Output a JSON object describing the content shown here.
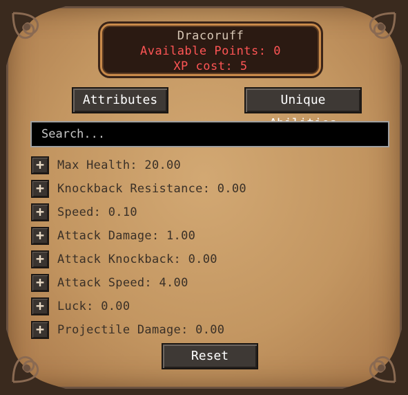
{
  "header": {
    "name": "Dracoruff",
    "available_points": "Available Points: 0",
    "xp_cost": "XP cost: 5"
  },
  "tabs": {
    "attributes_label": "Attributes",
    "unique_label": "Unique Abilities"
  },
  "search": {
    "placeholder": "Search..."
  },
  "attributes": [
    {
      "label": "Max Health: 20.00"
    },
    {
      "label": "Knockback Resistance: 0.00"
    },
    {
      "label": "Speed: 0.10"
    },
    {
      "label": "Attack Damage: 1.00"
    },
    {
      "label": "Attack Knockback: 0.00"
    },
    {
      "label": "Attack Speed: 4.00"
    },
    {
      "label": "Luck: 0.00"
    },
    {
      "label": "Projectile Damage: 0.00"
    }
  ],
  "plus_symbol": "+",
  "reset_label": "Reset",
  "colors": {
    "parchment": "#c39661",
    "highlight_red": "#ff5555",
    "frame_dark": "#3a2a1e"
  }
}
